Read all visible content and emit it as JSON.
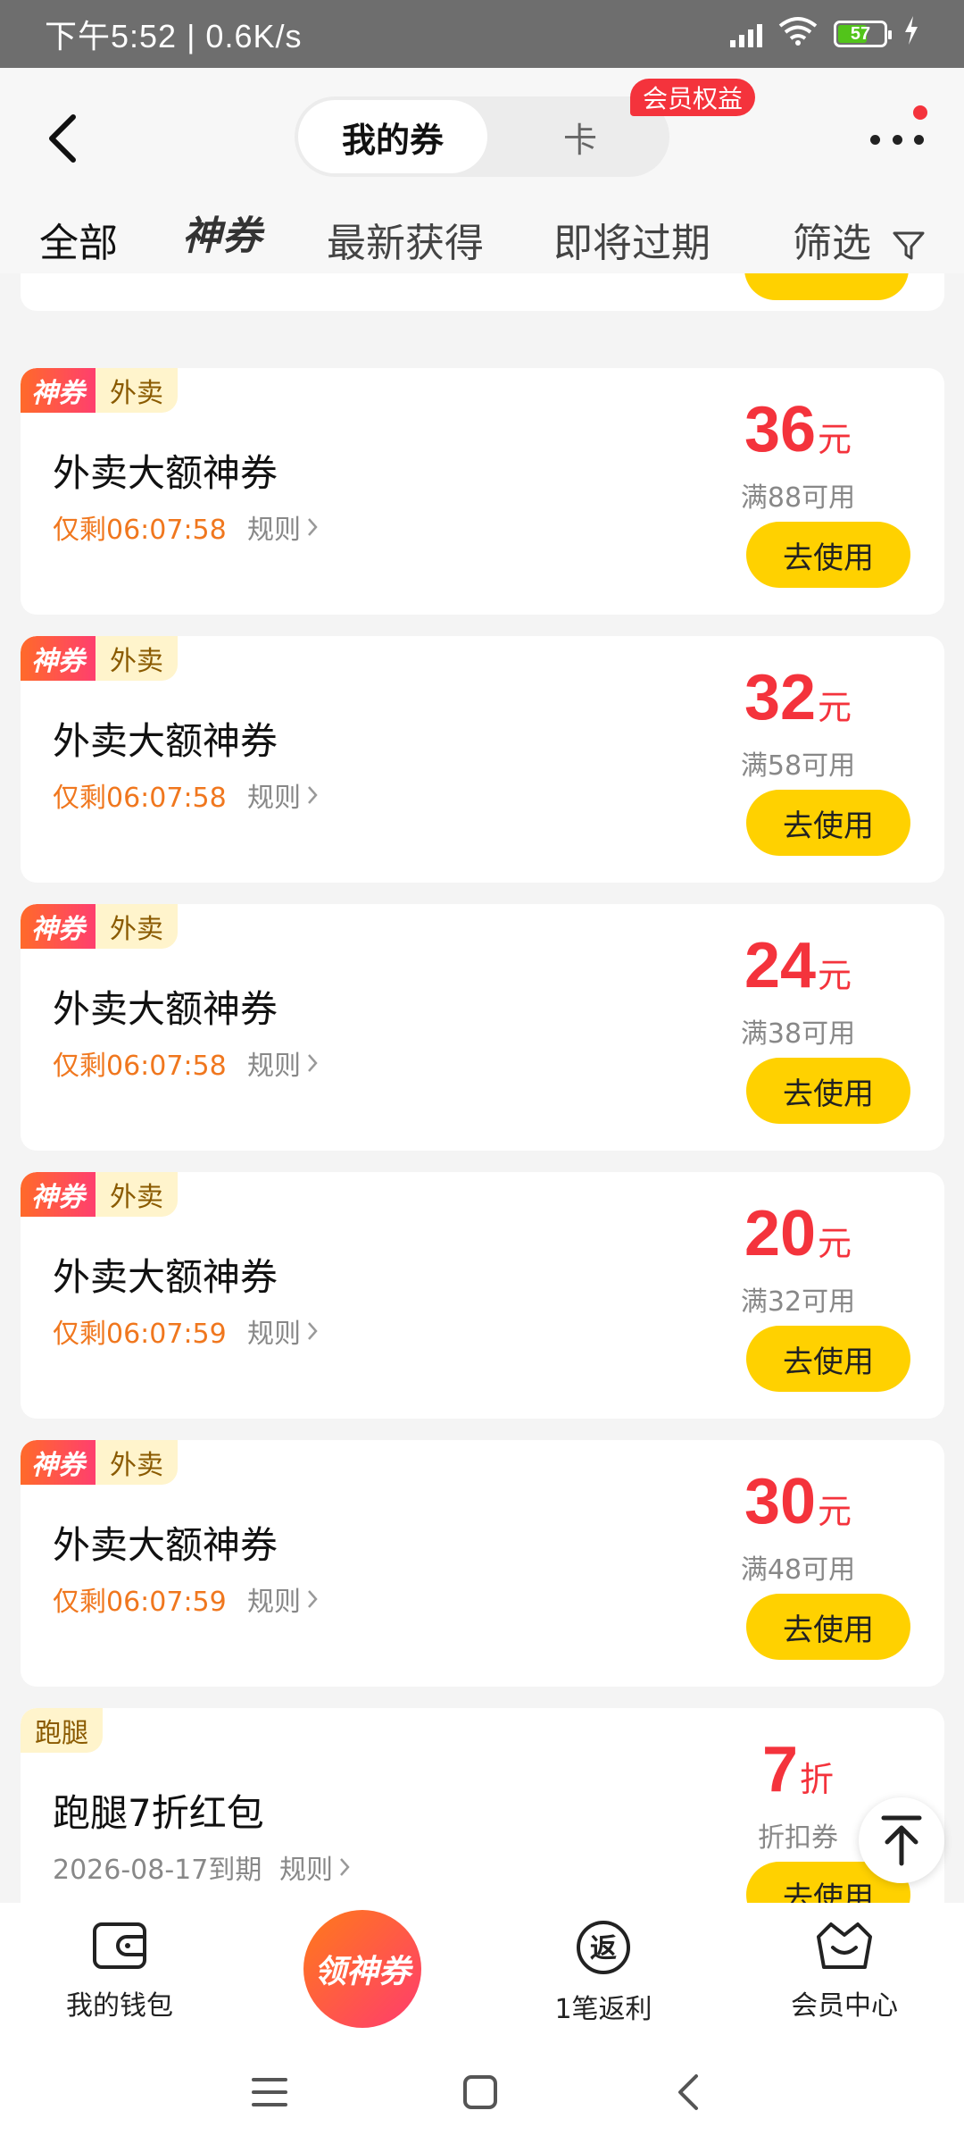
{
  "status": {
    "time": "下午5:52 | 0.6K/s",
    "battery": "57"
  },
  "header": {
    "seg_active": "我的券",
    "seg_other": "卡",
    "badge": "会员权益"
  },
  "tabs": [
    {
      "label": "全部"
    },
    {
      "label": "神券"
    },
    {
      "label": "最新获得"
    },
    {
      "label": "即将过期"
    },
    {
      "label": "筛选"
    }
  ],
  "coupons": [
    {
      "tag_main": "神券",
      "tag_cat": "外卖",
      "title": "外卖大额神券",
      "expire": "仅剩06:07:58",
      "rule": "规则",
      "amount": "36",
      "unit": "元",
      "condition": "满88可用",
      "button": "去使用"
    },
    {
      "tag_main": "神券",
      "tag_cat": "外卖",
      "title": "外卖大额神券",
      "expire": "仅剩06:07:58",
      "rule": "规则",
      "amount": "32",
      "unit": "元",
      "condition": "满58可用",
      "button": "去使用"
    },
    {
      "tag_main": "神券",
      "tag_cat": "外卖",
      "title": "外卖大额神券",
      "expire": "仅剩06:07:58",
      "rule": "规则",
      "amount": "24",
      "unit": "元",
      "condition": "满38可用",
      "button": "去使用"
    },
    {
      "tag_main": "神券",
      "tag_cat": "外卖",
      "title": "外卖大额神券",
      "expire": "仅剩06:07:59",
      "rule": "规则",
      "amount": "20",
      "unit": "元",
      "condition": "满32可用",
      "button": "去使用"
    },
    {
      "tag_main": "神券",
      "tag_cat": "外卖",
      "title": "外卖大额神券",
      "expire": "仅剩06:07:59",
      "rule": "规则",
      "amount": "30",
      "unit": "元",
      "condition": "满48可用",
      "button": "去使用"
    },
    {
      "tag_cat": "跑腿",
      "title": "跑腿7折红包",
      "expire": "2026-08-17到期",
      "rule": "规则",
      "amount": "7",
      "unit": "折",
      "condition": "折扣券",
      "button": "去使用"
    }
  ],
  "bottom_nav": {
    "wallet": "我的钱包",
    "center": "领神券",
    "rebate_icon": "返",
    "rebate": "1笔返利",
    "member": "会员中心"
  },
  "colors": {
    "accent_yellow": "#ffd100",
    "price_red": "#f4333c",
    "expire_orange": "#f0771e"
  }
}
